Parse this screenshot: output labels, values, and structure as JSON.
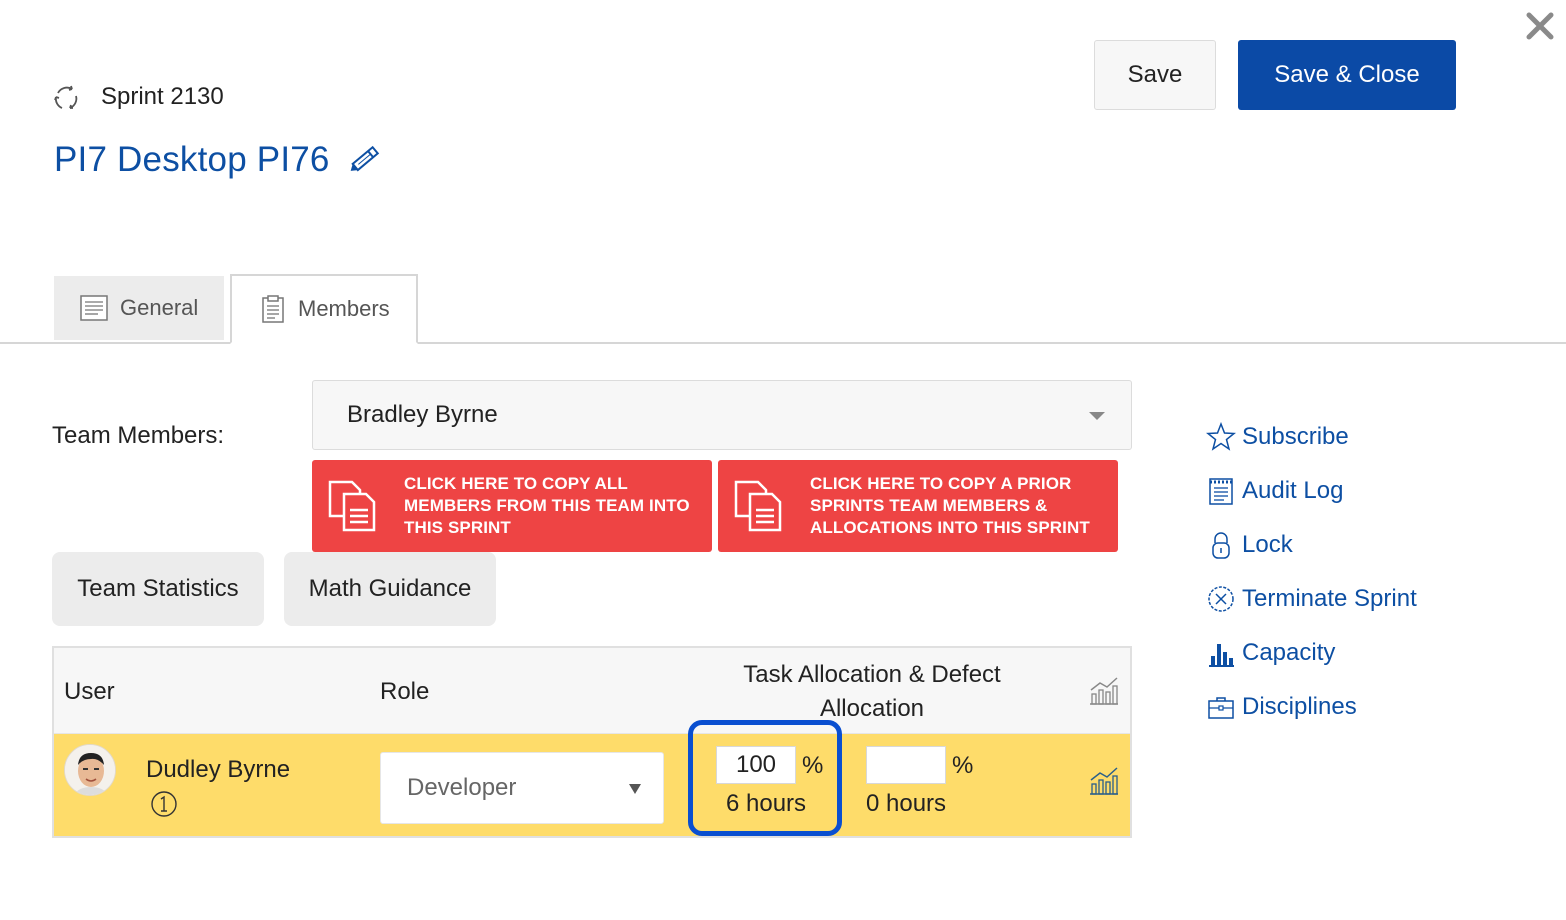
{
  "header": {
    "sprint_label": "Sprint 2130",
    "title": "PI7 Desktop PI76",
    "save_label": "Save",
    "save_close_label": "Save & Close"
  },
  "tabs": [
    {
      "label": "General",
      "icon": "document-icon",
      "active": false
    },
    {
      "label": "Members",
      "icon": "clipboard-icon",
      "active": true
    }
  ],
  "team_members": {
    "label": "Team Members:",
    "selected": "Bradley Byrne"
  },
  "copy_buttons": [
    {
      "label": "Click here to copy all members from this team into this sprint"
    },
    {
      "label": "Click here to copy a prior sprints team members & allocations into this sprint"
    }
  ],
  "action_buttons": {
    "team_statistics": "Team Statistics",
    "math_guidance": "Math Guidance"
  },
  "table": {
    "columns": {
      "user": "User",
      "role": "Role",
      "allocation": "Task Allocation & Defect Allocation"
    },
    "rows": [
      {
        "user": "Dudley Byrne",
        "role": "Developer",
        "task_allocation_pct": "100",
        "task_hours": "6 hours",
        "defect_allocation_pct": "",
        "defect_hours": "0 hours",
        "pct_symbol": "%"
      }
    ]
  },
  "side_menu": [
    {
      "label": "Subscribe",
      "icon": "star-icon"
    },
    {
      "label": "Audit Log",
      "icon": "log-icon"
    },
    {
      "label": "Lock",
      "icon": "lock-icon"
    },
    {
      "label": "Terminate Sprint",
      "icon": "terminate-icon"
    },
    {
      "label": "Capacity",
      "icon": "bar-chart-icon"
    },
    {
      "label": "Disciplines",
      "icon": "briefcase-icon"
    }
  ],
  "colors": {
    "brand_blue": "#0b4aa6",
    "link_blue": "#0d4fa3",
    "danger_red": "#ee4444",
    "row_highlight": "#fedc6a",
    "focus_ring": "#0a4fd0"
  }
}
